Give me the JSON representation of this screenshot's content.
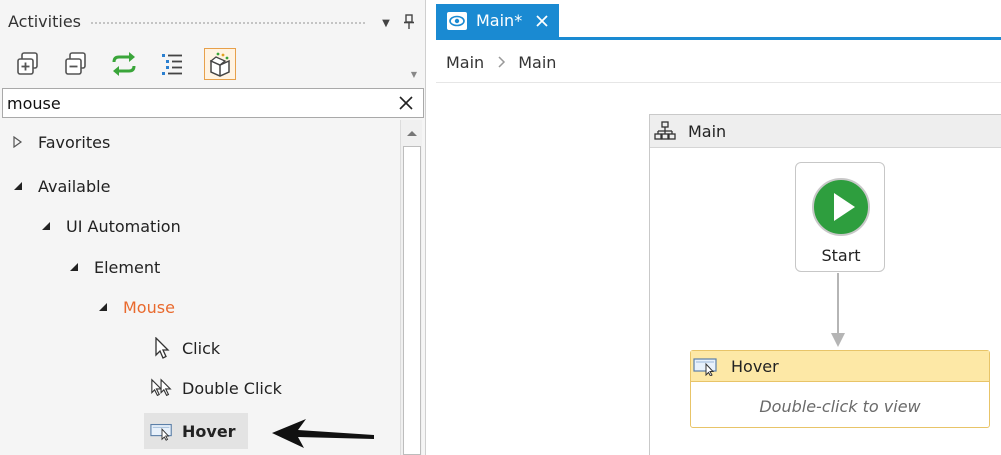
{
  "activities_panel": {
    "title": "Activities",
    "toolbar": [
      {
        "name": "expand-all-button",
        "icon": "expand-all-icon"
      },
      {
        "name": "collapse-all-button",
        "icon": "collapse-all-icon"
      },
      {
        "name": "refresh-button",
        "icon": "refresh-icon"
      },
      {
        "name": "view-options-button",
        "icon": "list-view-icon"
      },
      {
        "name": "available-activities-button",
        "icon": "package-icon",
        "active": true
      }
    ],
    "search": {
      "value": "mouse",
      "placeholder": ""
    },
    "tree": {
      "favorites": "Favorites",
      "available": "Available",
      "ui_automation": "UI Automation",
      "element": "Element",
      "mouse": "Mouse",
      "click": "Click",
      "double_click": "Double Click",
      "hover": "Hover"
    }
  },
  "designer": {
    "tab": {
      "label": "Main*",
      "icon": "workflow-eye-icon",
      "close_icon": "close-icon"
    },
    "breadcrumb": [
      "Main",
      "Main"
    ],
    "flowchart": {
      "title": "Main",
      "start_label": "Start",
      "activity": {
        "title": "Hover",
        "hint": "Double-click to view"
      }
    }
  },
  "colors": {
    "accent": "#1a8ad2",
    "mouse_category": "#e96a2e",
    "start_green": "#2e9e3e",
    "activity_header": "#fde8a6",
    "activity_border": "#e8c468"
  }
}
